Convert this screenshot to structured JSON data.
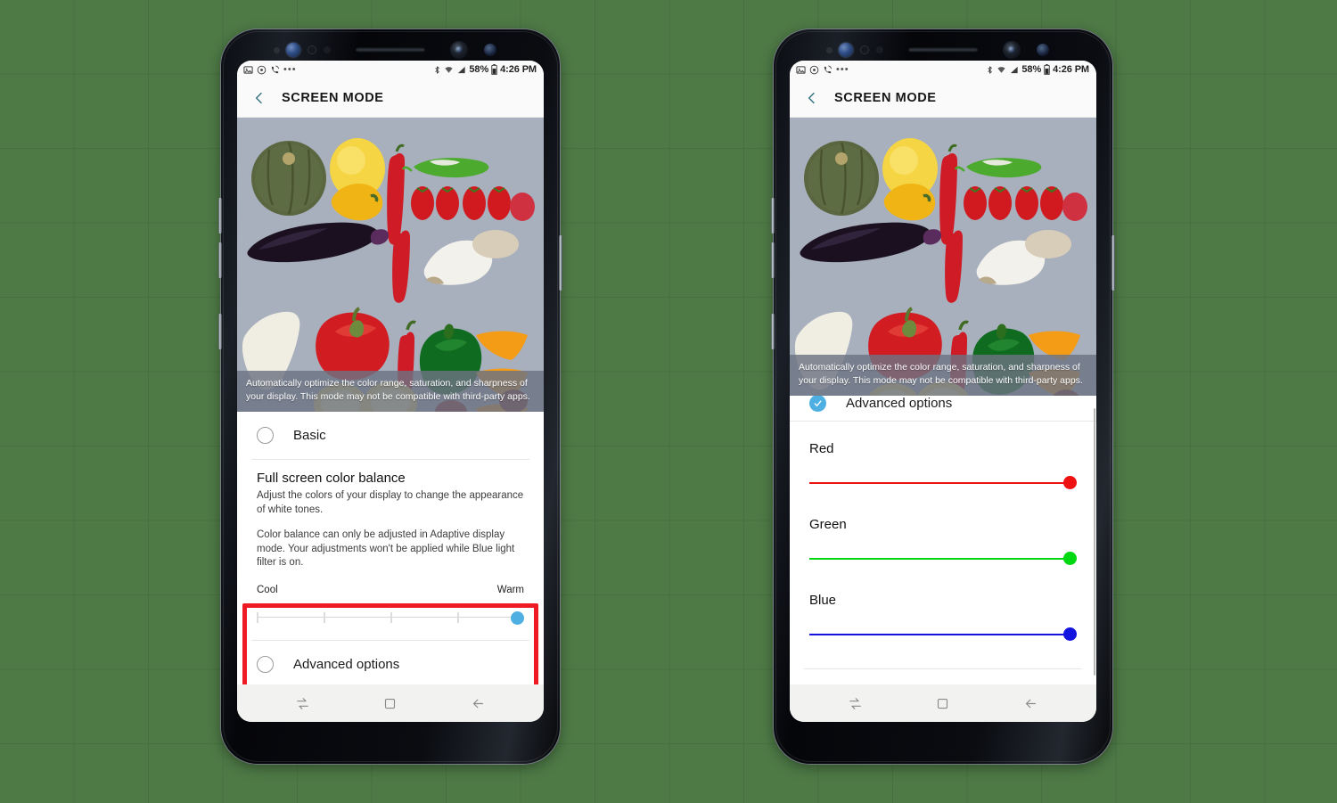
{
  "background": {
    "color": "#4e7a46",
    "grid": true
  },
  "phones": [
    {
      "id": "left",
      "status_bar": {
        "left_icons": [
          "image-icon",
          "circle-icon",
          "call-wifi-icon",
          "more-dots-icon"
        ],
        "bluetooth": "bluetooth-icon",
        "wifi": "wifi-icon",
        "signal": "signal-icon",
        "battery_percent": "58%",
        "battery": "battery-icon",
        "time": "4:26 PM"
      },
      "app_bar": {
        "back": "back-chevron-icon",
        "title": "SCREEN MODE"
      },
      "preview": {
        "caption": "Automatically optimize the color range, saturation, and sharpness of your display. This mode may not be compatible with third-party apps."
      },
      "options": [
        {
          "label": "Basic",
          "checked": false
        }
      ],
      "color_balance": {
        "title": "Full screen color balance",
        "description": "Adjust the colors of your display to change the appearance of white tones.",
        "note": "Color balance can only be adjusted in Adaptive display mode. Your adjustments won't be applied while Blue light filter is on.",
        "slider": {
          "min_label": "Cool",
          "max_label": "Warm",
          "value_percent": 100,
          "ticks": 5,
          "thumb_color": "#4eb0e2"
        }
      },
      "advanced_options": {
        "label": "Advanced options",
        "checked": false
      },
      "highlight": {
        "color": "#ee1b24"
      },
      "nav_bar": [
        "recents-icon",
        "home-icon",
        "back-icon"
      ]
    },
    {
      "id": "right",
      "status_bar": {
        "left_icons": [
          "image-icon",
          "circle-icon",
          "call-wifi-icon",
          "more-dots-icon"
        ],
        "bluetooth": "bluetooth-icon",
        "wifi": "wifi-icon",
        "signal": "signal-icon",
        "battery_percent": "58%",
        "battery": "battery-icon",
        "time": "4:26 PM"
      },
      "app_bar": {
        "back": "back-chevron-icon",
        "title": "SCREEN MODE"
      },
      "preview": {
        "caption": "Automatically optimize the color range, saturation, and sharpness of your display. This mode may not be compatible with third-party apps."
      },
      "advanced_options": {
        "label": "Advanced options",
        "checked": true,
        "check_color": "#4eb0e2"
      },
      "rgb_sliders": [
        {
          "label": "Red",
          "color": "#ee1111",
          "value_percent": 100
        },
        {
          "label": "Green",
          "color": "#00d811",
          "value_percent": 100
        },
        {
          "label": "Blue",
          "color": "#1414e0",
          "value_percent": 100
        }
      ],
      "nav_bar": [
        "recents-icon",
        "home-icon",
        "back-icon"
      ]
    }
  ]
}
